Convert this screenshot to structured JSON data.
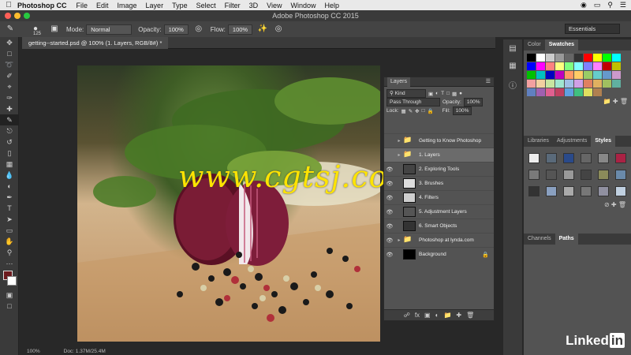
{
  "menubar": {
    "app_name": "Photoshop CC",
    "items": [
      "File",
      "Edit",
      "Image",
      "Layer",
      "Type",
      "Select",
      "Filter",
      "3D",
      "View",
      "Window",
      "Help"
    ]
  },
  "window_title": "Adobe Photoshop CC 2015",
  "options_bar": {
    "brush_size": "125",
    "mode_label": "Mode:",
    "mode_value": "Normal",
    "opacity_label": "Opacity:",
    "opacity_value": "100%",
    "flow_label": "Flow:",
    "flow_value": "100%",
    "workspace": "Essentials"
  },
  "document_tab": "getting--started.psd @ 100% (1. Layers, RGB/8#) *",
  "status": {
    "zoom": "100%",
    "doc_size": "Doc: 1.37M/25.4M"
  },
  "watermark": "www.cgtsj.com",
  "layers_panel": {
    "title": "Layers",
    "filter_kind": "Kind",
    "blend_mode": "Pass Through",
    "opacity_label": "Opacity:",
    "opacity_value": "100%",
    "lock_label": "Lock:",
    "fill_label": "Fill:",
    "fill_value": "100%",
    "layers": [
      {
        "name": "Getting to Know Photoshop",
        "type": "group",
        "visible": false,
        "selected": false
      },
      {
        "name": "1. Layers",
        "type": "group",
        "visible": false,
        "selected": true
      },
      {
        "name": "2. Exploring Tools",
        "type": "layer",
        "visible": true,
        "selected": false
      },
      {
        "name": "3. Brushes",
        "type": "layer",
        "visible": true,
        "selected": false
      },
      {
        "name": "4. Filters",
        "type": "layer",
        "visible": true,
        "selected": false
      },
      {
        "name": "5. Adjustment Layers",
        "type": "layer",
        "visible": true,
        "selected": false
      },
      {
        "name": "6. Smart Objects",
        "type": "layer",
        "visible": true,
        "selected": false
      },
      {
        "name": "Photoshop at lynda.com",
        "type": "group",
        "visible": true,
        "selected": false
      },
      {
        "name": "Background",
        "type": "background",
        "visible": true,
        "selected": false
      }
    ]
  },
  "right_panels": {
    "color_tab": "Color",
    "swatches_tab": "Swatches",
    "libraries_tab": "Libraries",
    "adjustments_tab": "Adjustments",
    "styles_tab": "Styles",
    "channels_tab": "Channels",
    "paths_tab": "Paths"
  },
  "branding": {
    "linked": "Linked",
    "in": "in"
  },
  "colors": {
    "foreground": "#6b1a1e",
    "background": "#ffffff",
    "accent_watermark": "#ffe400"
  }
}
